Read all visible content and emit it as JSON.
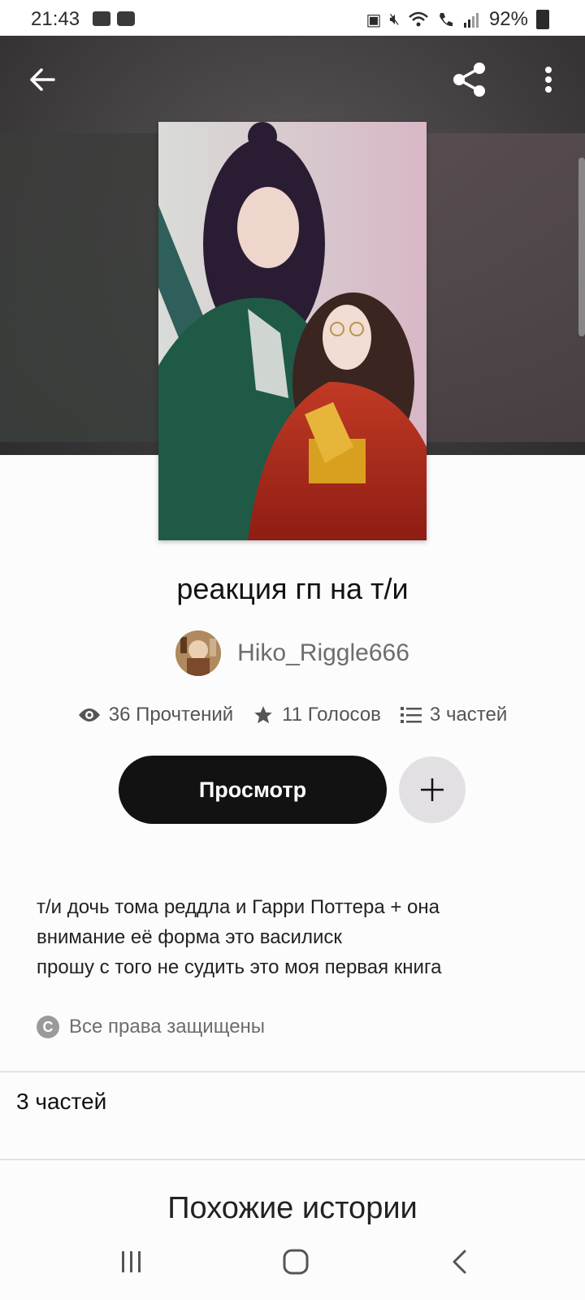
{
  "status_bar": {
    "time": "21:43",
    "battery": "92%",
    "left_icons": [
      "video-icon",
      "clock-icon"
    ],
    "right_icons": [
      "battery-saver-icon",
      "mute-icon",
      "wifi-icon",
      "call-icon",
      "signal-icon"
    ]
  },
  "header": {
    "icons": [
      "back-arrow-icon",
      "share-icon",
      "more-vert-icon"
    ]
  },
  "story": {
    "title": "реакция гп на т/и",
    "author": "Hiko_Riggle666",
    "stats": {
      "reads": "36 Прочтений",
      "votes": "11 Голосов",
      "parts": "3 частей"
    },
    "read_button": "Просмотр",
    "description_lines": [
      "т/и дочь тома реддла и Гарри Поттера + она",
      "внимание её форма это василиск",
      "прошу с того не судить это моя первая книга"
    ],
    "copyright": "Все права защищены",
    "parts_heading": "3 частей",
    "similar_heading": "Похожие истории"
  },
  "nav_bar": {
    "icons": [
      "recent-apps-icon",
      "home-icon",
      "back-icon"
    ]
  },
  "colors": {
    "primary_button": "#121212",
    "secondary_button": "#e2e0e3",
    "muted_text": "#6d6d6d"
  }
}
